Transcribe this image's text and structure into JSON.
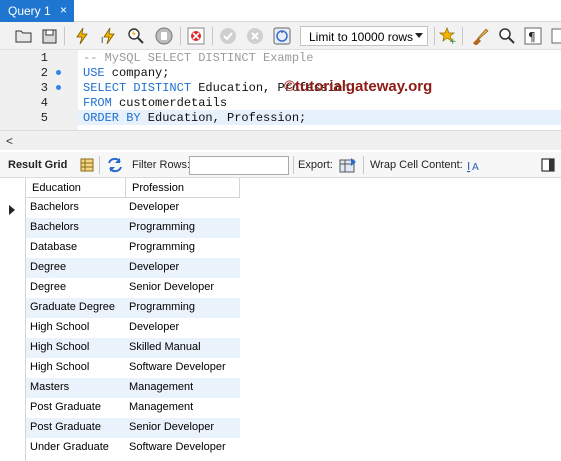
{
  "tab": {
    "label": "Query 1",
    "close": "×"
  },
  "toolbar": {
    "limit_label": "Limit to 10000 rows",
    "icons": [
      "open-folder-icon",
      "save-icon",
      "execute-icon",
      "execute-current-icon",
      "explain-icon",
      "stop-icon",
      "toggle-errors-icon",
      "commit-icon",
      "rollback-icon",
      "autocommit-icon",
      "beautify-icon",
      "find-icon",
      "invisible-chars-icon",
      "word-wrap-icon"
    ]
  },
  "editor": {
    "lines": [
      {
        "num": "1",
        "dot": false
      },
      {
        "num": "2",
        "dot": true
      },
      {
        "num": "3",
        "dot": true
      },
      {
        "num": "4",
        "dot": false
      },
      {
        "num": "5",
        "dot": false
      }
    ],
    "code": {
      "l1": "-- MySQL SELECT DISTINCT Example",
      "l2_kw": "USE",
      "l2_rest": " company;",
      "l3_kw": "SELECT DISTINCT",
      "l3_rest": " Education, Profession",
      "l4_kw": "FROM",
      "l4_rest": " customerdetails",
      "l5_kw": "ORDER BY",
      "l5_rest": " Education, Profession;"
    },
    "watermark": "©tutorialgateway.org"
  },
  "scroll": {
    "left_arrow": "<"
  },
  "result_bar": {
    "result_grid": "Result Grid",
    "filter_rows": "Filter Rows:",
    "export": "Export:",
    "wrap_cell": "Wrap Cell Content:"
  },
  "grid": {
    "columns": [
      "Education",
      "Profession"
    ],
    "rows": [
      [
        "Bachelors",
        "Developer"
      ],
      [
        "Bachelors",
        "Programming"
      ],
      [
        "Database",
        "Programming"
      ],
      [
        "Degree",
        "Developer"
      ],
      [
        "Degree",
        "Senior Developer"
      ],
      [
        "Graduate Degree",
        "Programming"
      ],
      [
        "High School",
        "Developer"
      ],
      [
        "High School",
        "Skilled Manual"
      ],
      [
        "High School",
        "Software Developer"
      ],
      [
        "Masters",
        "Management"
      ],
      [
        "Post Graduate",
        "Management"
      ],
      [
        "Post Graduate",
        "Senior Developer"
      ],
      [
        "Under Graduate",
        "Software Developer"
      ]
    ]
  },
  "colors": {
    "tab_active": "#1e76d0",
    "keyword": "#1f6fd1",
    "comment": "#9a9a9a",
    "watermark": "#8e1b14",
    "row_alt": "#eaf2fb"
  }
}
